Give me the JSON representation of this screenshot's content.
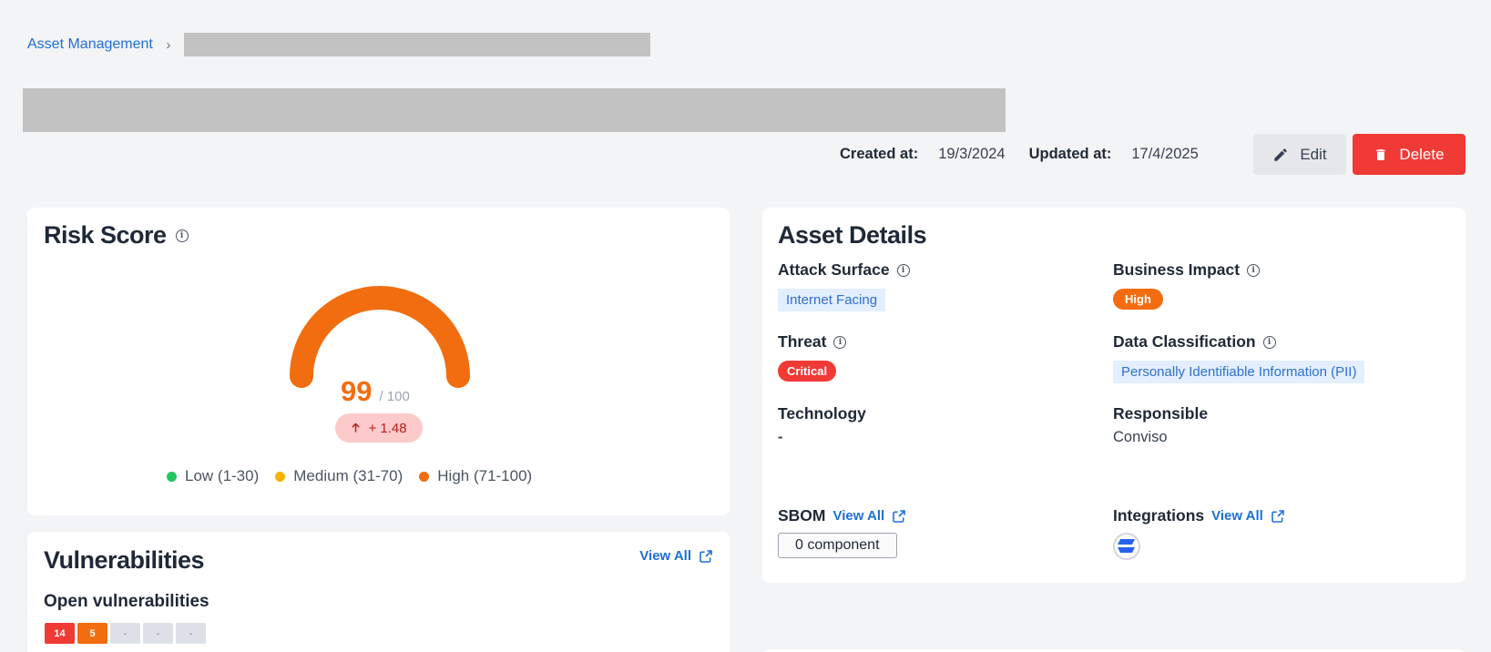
{
  "breadcrumb": {
    "root": "Asset Management"
  },
  "meta": {
    "created_label": "Created at:",
    "created_value": "19/3/2024",
    "updated_label": "Updated at:",
    "updated_value": "17/4/2025"
  },
  "actions": {
    "edit": "Edit",
    "delete": "Delete"
  },
  "risk": {
    "title": "Risk Score",
    "score": "99",
    "max": "/ 100",
    "delta": "+ 1.48",
    "legend": [
      {
        "label": "Low (1-30)",
        "color": "#22c55e"
      },
      {
        "label": "Medium (31-70)",
        "color": "#f5b400"
      },
      {
        "label": "High (71-100)",
        "color": "#f26d10"
      }
    ],
    "gauge_color": "#f26d10",
    "score_fraction": 0.99
  },
  "vulnerabilities": {
    "title": "Vulnerabilities",
    "view_all": "View All",
    "subtitle": "Open vulnerabilities",
    "counts": [
      "14",
      "5",
      "-",
      "-",
      "-"
    ]
  },
  "details": {
    "title": "Asset Details",
    "attack_surface": {
      "label": "Attack Surface",
      "value": "Internet Facing"
    },
    "business_impact": {
      "label": "Business Impact",
      "value": "High"
    },
    "threat": {
      "label": "Threat",
      "value": "Critical"
    },
    "data_classification": {
      "label": "Data Classification",
      "value": "Personally Identifiable Information (PII)"
    },
    "technology": {
      "label": "Technology",
      "value": "-"
    },
    "responsible": {
      "label": "Responsible",
      "value": "Conviso"
    },
    "sbom": {
      "label": "SBOM",
      "view_all": "View All",
      "components": "0 component"
    },
    "integrations": {
      "label": "Integrations",
      "view_all": "View All"
    }
  }
}
